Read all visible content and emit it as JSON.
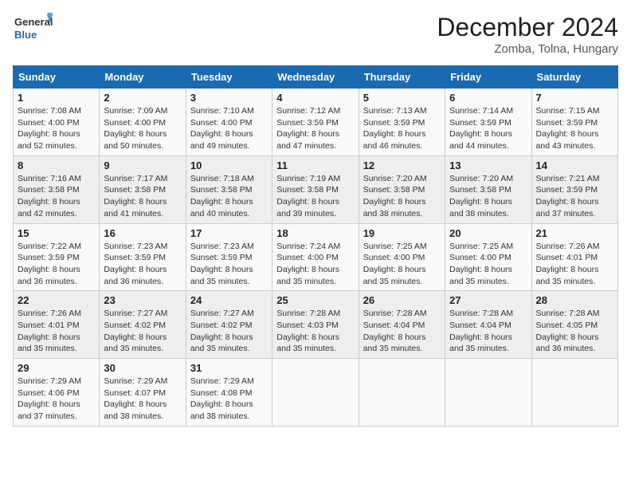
{
  "header": {
    "logo_line1": "General",
    "logo_line2": "Blue",
    "month_title": "December 2024",
    "location": "Zomba, Tolna, Hungary"
  },
  "weekdays": [
    "Sunday",
    "Monday",
    "Tuesday",
    "Wednesday",
    "Thursday",
    "Friday",
    "Saturday"
  ],
  "weeks": [
    [
      {
        "day": "1",
        "sunrise": "Sunrise: 7:08 AM",
        "sunset": "Sunset: 4:00 PM",
        "daylight": "Daylight: 8 hours and 52 minutes."
      },
      {
        "day": "2",
        "sunrise": "Sunrise: 7:09 AM",
        "sunset": "Sunset: 4:00 PM",
        "daylight": "Daylight: 8 hours and 50 minutes."
      },
      {
        "day": "3",
        "sunrise": "Sunrise: 7:10 AM",
        "sunset": "Sunset: 4:00 PM",
        "daylight": "Daylight: 8 hours and 49 minutes."
      },
      {
        "day": "4",
        "sunrise": "Sunrise: 7:12 AM",
        "sunset": "Sunset: 3:59 PM",
        "daylight": "Daylight: 8 hours and 47 minutes."
      },
      {
        "day": "5",
        "sunrise": "Sunrise: 7:13 AM",
        "sunset": "Sunset: 3:59 PM",
        "daylight": "Daylight: 8 hours and 46 minutes."
      },
      {
        "day": "6",
        "sunrise": "Sunrise: 7:14 AM",
        "sunset": "Sunset: 3:59 PM",
        "daylight": "Daylight: 8 hours and 44 minutes."
      },
      {
        "day": "7",
        "sunrise": "Sunrise: 7:15 AM",
        "sunset": "Sunset: 3:59 PM",
        "daylight": "Daylight: 8 hours and 43 minutes."
      }
    ],
    [
      {
        "day": "8",
        "sunrise": "Sunrise: 7:16 AM",
        "sunset": "Sunset: 3:58 PM",
        "daylight": "Daylight: 8 hours and 42 minutes."
      },
      {
        "day": "9",
        "sunrise": "Sunrise: 7:17 AM",
        "sunset": "Sunset: 3:58 PM",
        "daylight": "Daylight: 8 hours and 41 minutes."
      },
      {
        "day": "10",
        "sunrise": "Sunrise: 7:18 AM",
        "sunset": "Sunset: 3:58 PM",
        "daylight": "Daylight: 8 hours and 40 minutes."
      },
      {
        "day": "11",
        "sunrise": "Sunrise: 7:19 AM",
        "sunset": "Sunset: 3:58 PM",
        "daylight": "Daylight: 8 hours and 39 minutes."
      },
      {
        "day": "12",
        "sunrise": "Sunrise: 7:20 AM",
        "sunset": "Sunset: 3:58 PM",
        "daylight": "Daylight: 8 hours and 38 minutes."
      },
      {
        "day": "13",
        "sunrise": "Sunrise: 7:20 AM",
        "sunset": "Sunset: 3:58 PM",
        "daylight": "Daylight: 8 hours and 38 minutes."
      },
      {
        "day": "14",
        "sunrise": "Sunrise: 7:21 AM",
        "sunset": "Sunset: 3:59 PM",
        "daylight": "Daylight: 8 hours and 37 minutes."
      }
    ],
    [
      {
        "day": "15",
        "sunrise": "Sunrise: 7:22 AM",
        "sunset": "Sunset: 3:59 PM",
        "daylight": "Daylight: 8 hours and 36 minutes."
      },
      {
        "day": "16",
        "sunrise": "Sunrise: 7:23 AM",
        "sunset": "Sunset: 3:59 PM",
        "daylight": "Daylight: 8 hours and 36 minutes."
      },
      {
        "day": "17",
        "sunrise": "Sunrise: 7:23 AM",
        "sunset": "Sunset: 3:59 PM",
        "daylight": "Daylight: 8 hours and 35 minutes."
      },
      {
        "day": "18",
        "sunrise": "Sunrise: 7:24 AM",
        "sunset": "Sunset: 4:00 PM",
        "daylight": "Daylight: 8 hours and 35 minutes."
      },
      {
        "day": "19",
        "sunrise": "Sunrise: 7:25 AM",
        "sunset": "Sunset: 4:00 PM",
        "daylight": "Daylight: 8 hours and 35 minutes."
      },
      {
        "day": "20",
        "sunrise": "Sunrise: 7:25 AM",
        "sunset": "Sunset: 4:00 PM",
        "daylight": "Daylight: 8 hours and 35 minutes."
      },
      {
        "day": "21",
        "sunrise": "Sunrise: 7:26 AM",
        "sunset": "Sunset: 4:01 PM",
        "daylight": "Daylight: 8 hours and 35 minutes."
      }
    ],
    [
      {
        "day": "22",
        "sunrise": "Sunrise: 7:26 AM",
        "sunset": "Sunset: 4:01 PM",
        "daylight": "Daylight: 8 hours and 35 minutes."
      },
      {
        "day": "23",
        "sunrise": "Sunrise: 7:27 AM",
        "sunset": "Sunset: 4:02 PM",
        "daylight": "Daylight: 8 hours and 35 minutes."
      },
      {
        "day": "24",
        "sunrise": "Sunrise: 7:27 AM",
        "sunset": "Sunset: 4:02 PM",
        "daylight": "Daylight: 8 hours and 35 minutes."
      },
      {
        "day": "25",
        "sunrise": "Sunrise: 7:28 AM",
        "sunset": "Sunset: 4:03 PM",
        "daylight": "Daylight: 8 hours and 35 minutes."
      },
      {
        "day": "26",
        "sunrise": "Sunrise: 7:28 AM",
        "sunset": "Sunset: 4:04 PM",
        "daylight": "Daylight: 8 hours and 35 minutes."
      },
      {
        "day": "27",
        "sunrise": "Sunrise: 7:28 AM",
        "sunset": "Sunset: 4:04 PM",
        "daylight": "Daylight: 8 hours and 35 minutes."
      },
      {
        "day": "28",
        "sunrise": "Sunrise: 7:28 AM",
        "sunset": "Sunset: 4:05 PM",
        "daylight": "Daylight: 8 hours and 36 minutes."
      }
    ],
    [
      {
        "day": "29",
        "sunrise": "Sunrise: 7:29 AM",
        "sunset": "Sunset: 4:06 PM",
        "daylight": "Daylight: 8 hours and 37 minutes."
      },
      {
        "day": "30",
        "sunrise": "Sunrise: 7:29 AM",
        "sunset": "Sunset: 4:07 PM",
        "daylight": "Daylight: 8 hours and 38 minutes."
      },
      {
        "day": "31",
        "sunrise": "Sunrise: 7:29 AM",
        "sunset": "Sunset: 4:08 PM",
        "daylight": "Daylight: 8 hours and 38 minutes."
      },
      null,
      null,
      null,
      null
    ]
  ]
}
